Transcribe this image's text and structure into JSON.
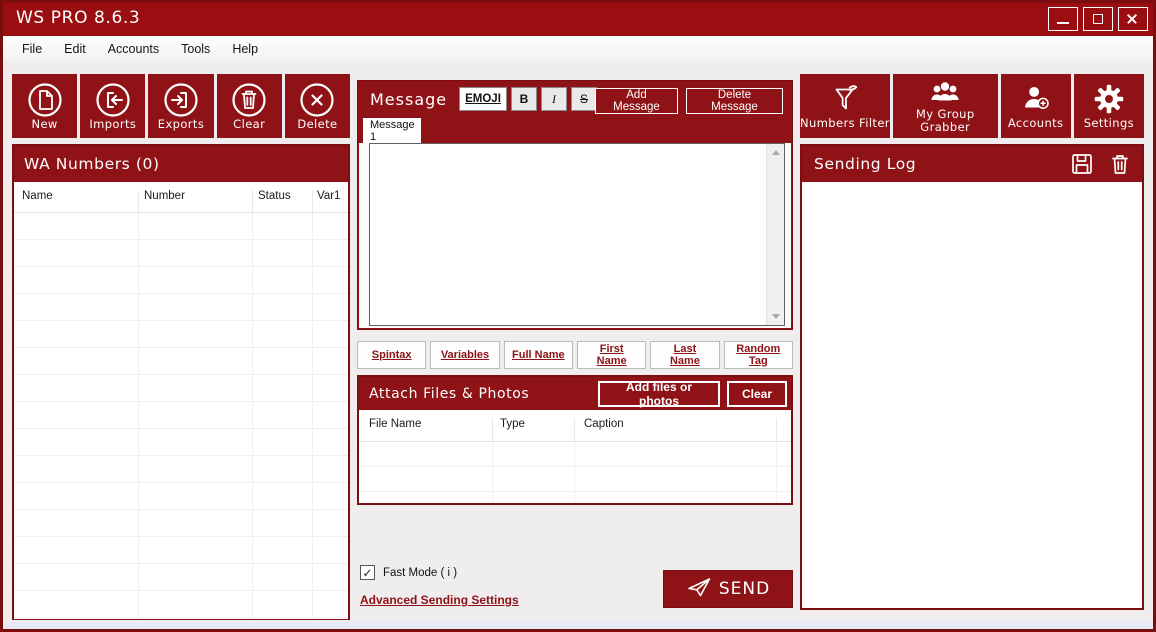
{
  "window": {
    "title": "WS PRO 8.6.3"
  },
  "menu": {
    "items": [
      {
        "label": "File"
      },
      {
        "label": "Edit"
      },
      {
        "label": "Accounts"
      },
      {
        "label": "Tools"
      },
      {
        "label": "Help"
      }
    ]
  },
  "left_toolbar": {
    "buttons": [
      {
        "label": "New",
        "icon": "new-document-icon"
      },
      {
        "label": "Imports",
        "icon": "import-icon"
      },
      {
        "label": "Exports",
        "icon": "export-icon"
      },
      {
        "label": "Clear",
        "icon": "clear-trash-icon"
      },
      {
        "label": "Delete",
        "icon": "delete-x-icon"
      }
    ]
  },
  "wa_numbers": {
    "title": "WA Numbers (0)",
    "count": 0,
    "columns": [
      {
        "label": "Name"
      },
      {
        "label": "Number"
      },
      {
        "label": "Status"
      },
      {
        "label": "Var1"
      }
    ],
    "rows": []
  },
  "message_panel": {
    "title": "Message",
    "emoji_button": "EMOJI",
    "bold_button": "B",
    "italic_button": "I",
    "strike_button": "S",
    "add_button": "Add Message",
    "delete_button": "Delete Message",
    "tab": "Message 1",
    "content": ""
  },
  "variable_buttons": [
    {
      "label": "Spintax"
    },
    {
      "label": "Variables"
    },
    {
      "label": "Full Name"
    },
    {
      "label": "First Name"
    },
    {
      "label": "Last Name"
    },
    {
      "label": "Random Tag"
    }
  ],
  "attach_panel": {
    "title": "Attach Files & Photos",
    "add_button": "Add files or photos",
    "clear_button": "Clear",
    "columns": [
      {
        "label": "File Name"
      },
      {
        "label": "Type"
      },
      {
        "label": "Caption"
      }
    ],
    "rows": []
  },
  "footer": {
    "fast_mode_label": "Fast Mode ( i )",
    "fast_mode_checked": true,
    "fast_mode_check_glyph": "✓",
    "advanced_link": "Advanced Sending Settings",
    "send_button": "SEND"
  },
  "right_toolbar": {
    "buttons": [
      {
        "label": "Numbers Filter",
        "icon": "filter-funnel-icon"
      },
      {
        "label": "My Group Grabber",
        "icon": "group-people-icon"
      },
      {
        "label": "Accounts",
        "icon": "add-account-icon"
      },
      {
        "label": "Settings",
        "icon": "gear-icon"
      }
    ]
  },
  "sending_log": {
    "title": "Sending Log",
    "entries": []
  },
  "colors": {
    "titlebar": "#9a0d10",
    "panel_maroon": "#8e1216",
    "border": "#7c0d10",
    "background": "#efedee",
    "link": "#8e1115"
  }
}
